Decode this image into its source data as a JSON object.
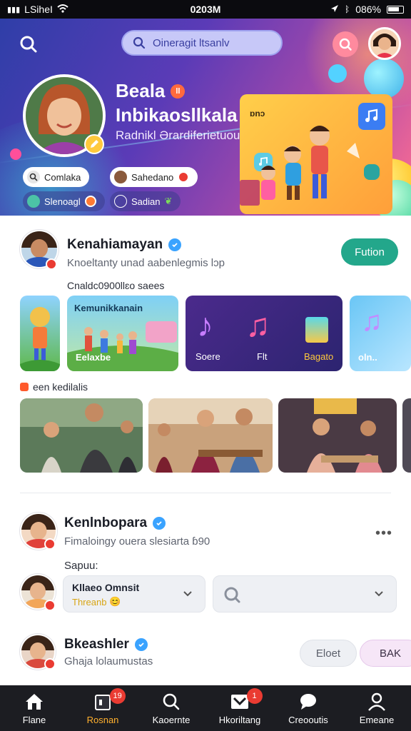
{
  "status_bar": {
    "carrier": "LSiheI",
    "time": "0203M",
    "battery": "086%"
  },
  "hero": {
    "search_placeholder": "Oineragit ltsanlv",
    "name": "Beala",
    "name_badge": "ll",
    "handle": "Inbikaosllkala",
    "tagline": "Radnikl Ərardiferietuou",
    "chips": [
      {
        "label": "Comlaka",
        "icon": "search-icon"
      },
      {
        "label": "Sahedano",
        "icon": "avatar-icon"
      },
      {
        "label": "Slenoagl",
        "icon": "avatar-icon"
      },
      {
        "label": "Sadian",
        "icon": "emoji-icon"
      }
    ],
    "promo_label": "ɒnɔ"
  },
  "post1": {
    "name": "Kenahiamayan",
    "subtitle": "Knoeltanty unad aabenlegmis lɔp",
    "follow_label": "Fution",
    "section_label": "Cnaldc0900llɛo saees",
    "cards": [
      {
        "caption": ""
      },
      {
        "title": "Kemunikkanain",
        "caption": "Eelaxbe"
      },
      {
        "items": [
          "Soere",
          "Flt",
          "Bagato"
        ]
      },
      {
        "caption": "oln.."
      }
    ],
    "feed_label": "een kedilalis"
  },
  "post2": {
    "name": "Kenlnbopara",
    "subtitle": "Fimaloingy ouera slesiarta ɓ90",
    "more_label": "•••",
    "reply_label": "Sapuu:",
    "select1": {
      "title": "Kllaeo Omnsit",
      "sub": "Threanb"
    },
    "select2": {
      "icon": "search-icon"
    }
  },
  "post3": {
    "name": "Bkeashler",
    "subtitle": "Ghaja lolaumustas",
    "btn1": "Eloet",
    "btn2": "BAK"
  },
  "bottom_nav": [
    {
      "label": "Flane",
      "icon": "home-icon",
      "active": false,
      "badge": ""
    },
    {
      "label": "Rosnan",
      "icon": "calendar-icon",
      "active": true,
      "badge": "19"
    },
    {
      "label": "Kaoernte",
      "icon": "search-icon",
      "active": false,
      "badge": ""
    },
    {
      "label": "Hkoriltang",
      "icon": "inbox-icon",
      "active": false,
      "badge": "1"
    },
    {
      "label": "Creooutis",
      "icon": "chat-icon",
      "active": false,
      "badge": ""
    },
    {
      "label": "Emeane",
      "icon": "profile-icon",
      "active": false,
      "badge": ""
    }
  ],
  "colors": {
    "accent_green": "#23a78b",
    "active_nav": "#ffb02e",
    "badge_red": "#ea3b32",
    "verified_blue": "#3aa3ff"
  }
}
